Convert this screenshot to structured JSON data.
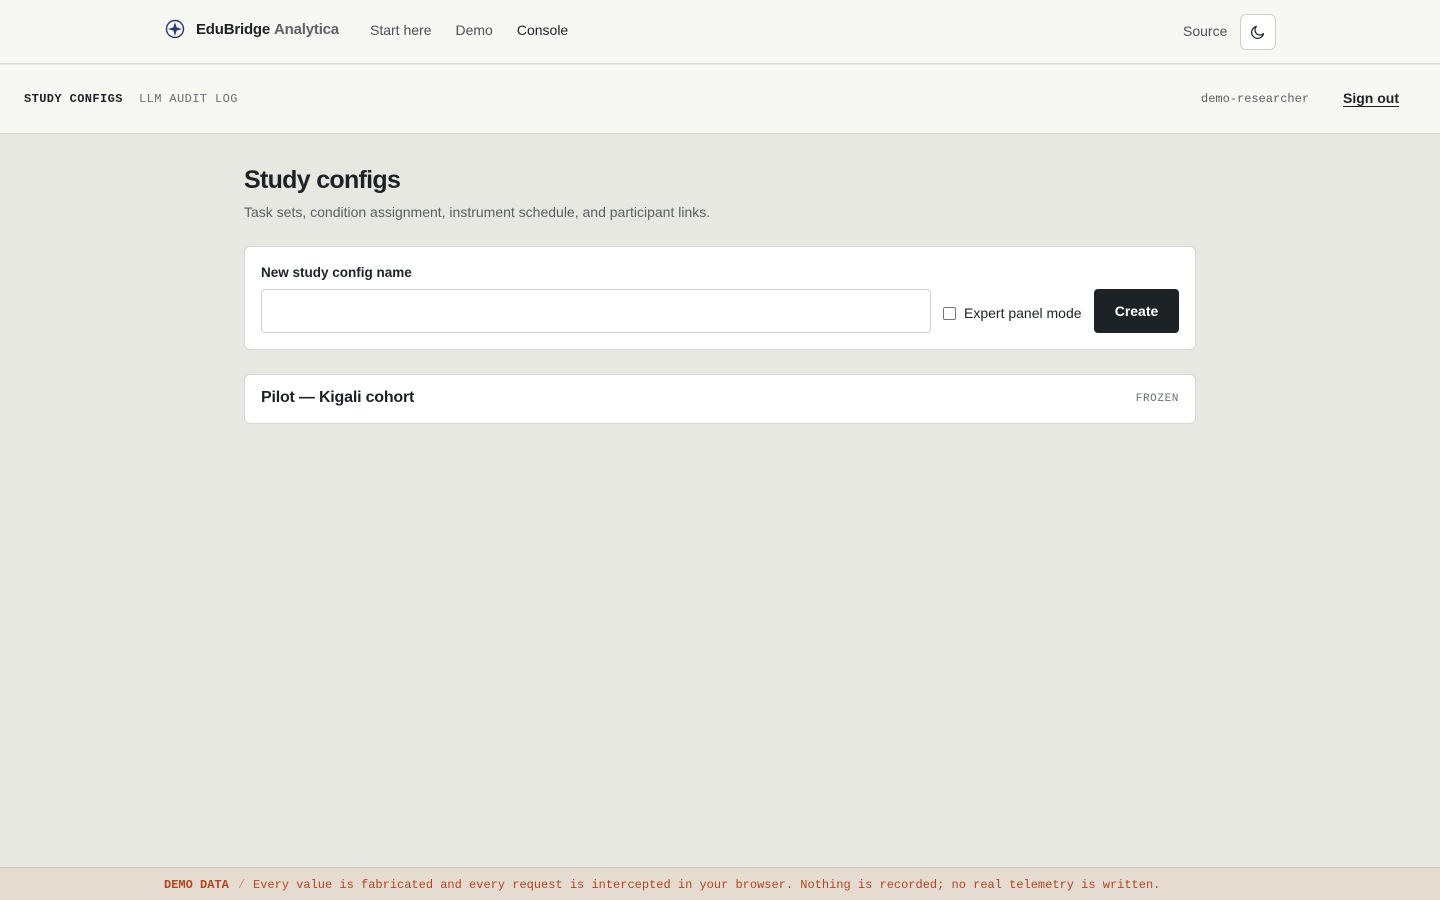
{
  "header": {
    "brand_name": "EduBridge",
    "brand_suffix": "Analytica",
    "brand_icon": "compass-icon",
    "nav": [
      {
        "label": "Start here"
      },
      {
        "label": "Demo"
      },
      {
        "label": "Console",
        "active": true
      }
    ],
    "source_label": "Source",
    "theme_icon": "moon-icon"
  },
  "subnav": {
    "tabs": [
      {
        "label": "STUDY CONFIGS",
        "active": true
      },
      {
        "label": "LLM AUDIT LOG",
        "active": false
      }
    ],
    "user": "demo-researcher",
    "signout_label": "Sign out"
  },
  "main": {
    "title": "Study configs",
    "subtitle": "Task sets, condition assignment, instrument schedule, and participant links.",
    "create_form": {
      "label": "New study config name",
      "input_value": "",
      "checkbox_label": "Expert panel mode",
      "checkbox_checked": false,
      "button_label": "Create"
    },
    "configs": [
      {
        "name": "Pilot — Kigali cohort",
        "status": "FROZEN"
      }
    ]
  },
  "banner": {
    "tag": "DEMO DATA",
    "separator": "/",
    "text": "Every value is fabricated and every request is intercepted in your browser. Nothing is recorded; no real telemetry is written."
  },
  "colors": {
    "background": "#e8e8e3",
    "surface": "#ffffff",
    "primary_button": "#1d2226",
    "banner_text": "#b0451e",
    "banner_bg": "#e6dbd0"
  }
}
